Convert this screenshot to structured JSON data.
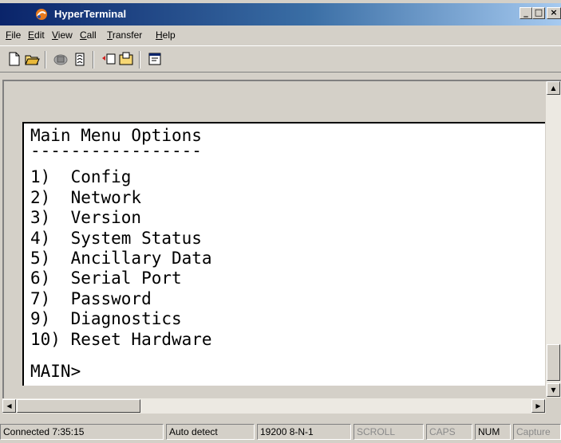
{
  "window": {
    "title": "HyperTerminal",
    "caption_buttons": {
      "minimize": "_",
      "maximize": "□",
      "close": "×"
    }
  },
  "menu": [
    {
      "label": "File",
      "accel": "F",
      "rest": "ile"
    },
    {
      "label": "Edit",
      "accel": "E",
      "rest": "dit"
    },
    {
      "label": "View",
      "accel": "V",
      "rest": "iew"
    },
    {
      "label": "Call",
      "accel": "C",
      "rest": "all"
    },
    {
      "label": "Transfer",
      "accel": "T",
      "rest": "ransfer"
    },
    {
      "label": "Help",
      "accel": "H",
      "rest": "elp"
    }
  ],
  "toolbar": {
    "icons": [
      "new-document-icon",
      "open-folder-icon",
      "connect-phone-icon",
      "disconnect-phone-icon",
      "send-file-icon",
      "receive-file-icon",
      "properties-icon"
    ]
  },
  "terminal": {
    "lines": [
      "Main Menu Options",
      "-----------------",
      "1)  Config",
      "2)  Network",
      "3)  Version",
      "4)  System Status",
      "5)  Ancillary Data",
      "6)  Serial Port",
      "7)  Password",
      "9)  Diagnostics",
      "10) Reset Hardware",
      "MAIN>"
    ]
  },
  "scroll": {
    "up": "▲",
    "down": "▼",
    "left": "◀",
    "right": "▶"
  },
  "status": {
    "connected": "Connected 7:35:15",
    "detect": "Auto detect",
    "settings": "19200 8-N-1",
    "scroll": "SCROLL",
    "caps": "CAPS",
    "num": "NUM",
    "capture": "Capture"
  },
  "colors": {
    "titlebar_start": "#0a246a",
    "titlebar_end": "#a6caf0",
    "chrome": "#d4d0c8",
    "terminal_bg": "#ffffff",
    "terminal_text": "#000000"
  }
}
